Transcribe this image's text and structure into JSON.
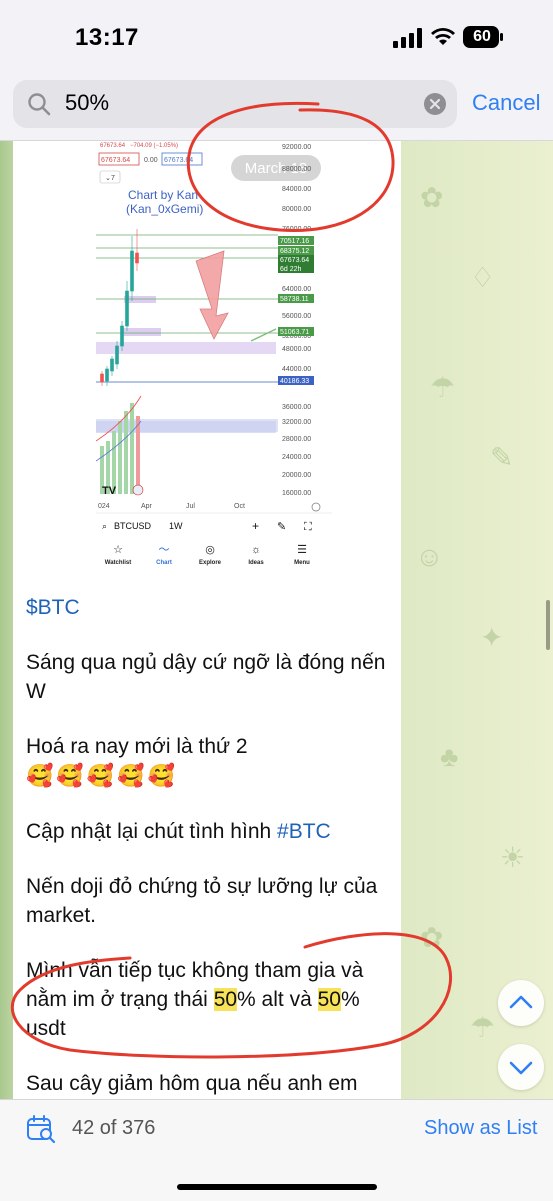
{
  "status": {
    "time": "13:17",
    "battery": "60"
  },
  "search": {
    "query": "50%",
    "cancel_label": "Cancel"
  },
  "photo": {
    "ticker_price": "67673.64",
    "ticker_change": "−704.09 (−1.05%)",
    "price_box_left": "67673.64",
    "price_box_mid": "0.00",
    "price_box_right": "67673.64",
    "indicator_count": "7",
    "date_badge": "March 18",
    "watermark_line1": "Chart by Kan",
    "watermark_line2": "(Kan_0xGemi)",
    "price_axis": [
      "92000.00",
      "88000.00",
      "84000.00",
      "80000.00",
      "76000.00",
      "64000.00",
      "60000.00",
      "56000.00",
      "52000.00",
      "48000.00",
      "44000.00",
      "36000.00",
      "32000.00",
      "28000.00",
      "24000.00",
      "20000.00",
      "16000.00"
    ],
    "price_tags": [
      "70517.16",
      "68375.12",
      "67673.64",
      "6d 22h",
      "58738.11",
      "51063.71",
      "40186.33"
    ],
    "time_axis": [
      "024",
      "Apr",
      "Jul",
      "Oct"
    ],
    "symbol": "BTCUSD",
    "interval": "1W",
    "tabs": [
      {
        "label": "Watchlist",
        "icon": "star-icon"
      },
      {
        "label": "Chart",
        "icon": "chart-icon"
      },
      {
        "label": "Explore",
        "icon": "compass-icon"
      },
      {
        "label": "Ideas",
        "icon": "bulb-icon"
      },
      {
        "label": "Menu",
        "icon": "menu-icon"
      }
    ]
  },
  "message": {
    "p1": "$BTC",
    "p2": "Sáng qua ngủ dậy cứ ngỡ là đóng nến W",
    "p3_text": "Hoá ra nay mới là thứ 2",
    "p3_emoji": "🥰🥰🥰🥰🥰",
    "p4_text": "Cập nhật lại chút tình hình ",
    "p4_tag": "#BTC",
    "p5": "Nến doji đỏ chứng tỏ sự lưỡng lự của market.",
    "p6_a": "Mình vẫn tiếp tục không tham gia và nằm im ở trạng thái ",
    "p6_hl1": "50",
    "p6_b": "% alt và ",
    "p6_hl2": "50",
    "p6_c": "% usdt",
    "p7": "Sau cây giảm hôm qua nếu anh em"
  },
  "bottom": {
    "counter": "42 of 376",
    "show_list_label": "Show as List"
  },
  "colors": {
    "accent": "#2f7ff5",
    "annotation": "#e23b2e",
    "highlight": "#f8e25a",
    "chat_bg": "#dfe9c4"
  }
}
